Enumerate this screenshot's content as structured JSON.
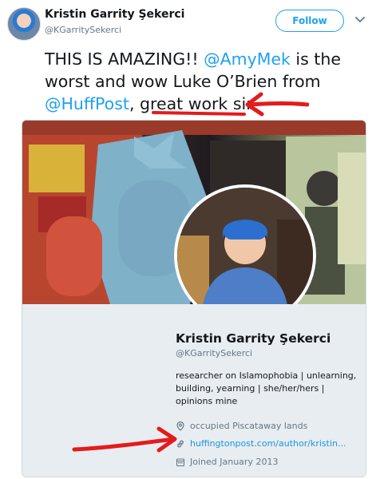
{
  "tweet": {
    "author_name": "Kristin Garrity Şekerci",
    "author_handle": "@KGarritySekerci",
    "follow_label": "Follow",
    "text_part1": "THIS IS AMAZING!! ",
    "mention1": "@AmyMek",
    "text_part2": " is the worst and wow Luke O’Brien from ",
    "mention2": "@HuffPost",
    "text_part3": ", great work sir."
  },
  "profile_card": {
    "name": "Kristin Garrity Şekerci",
    "handle": "@KGarritySekerci",
    "bio": "researcher on Islamophobia | unlearning, building, yearning | she/her/hers | opinions mine",
    "location": "occupied Piscataway lands",
    "link": "huffingtonpost.com/author/kristin...",
    "joined": "Joined January 2013"
  },
  "icons": {
    "location": "map-pin-icon",
    "link": "link-icon",
    "joined": "calendar-icon",
    "menu": "chevron-down-icon"
  },
  "colors": {
    "accent": "#1da1f2",
    "annotation": "#e41b1b",
    "muted_text": "#657786"
  }
}
